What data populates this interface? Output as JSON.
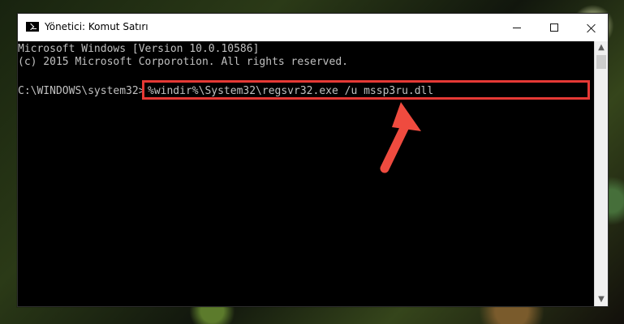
{
  "window": {
    "title": "Yönetici: Komut Satırı",
    "app_icon": "cmd-icon",
    "buttons": {
      "minimize_icon": "minimize-icon",
      "maximize_icon": "maximize-icon",
      "close_icon": "close-icon"
    }
  },
  "console": {
    "lines": [
      "Microsoft Windows [Version 10.0.10586]",
      "(c) 2015 Microsoft Corporotion. All rights reserved."
    ],
    "prompt": "C:\\WINDOWS\\system32>",
    "command": "%windir%\\System32\\regsvr32.exe /u mssp3ru.dll"
  },
  "annotation": {
    "highlight_color": "#e53935",
    "arrow_color": "#ef4b3f"
  },
  "scrollbar": {
    "up_icon": "scroll-up-icon",
    "down_icon": "scroll-down-icon"
  }
}
